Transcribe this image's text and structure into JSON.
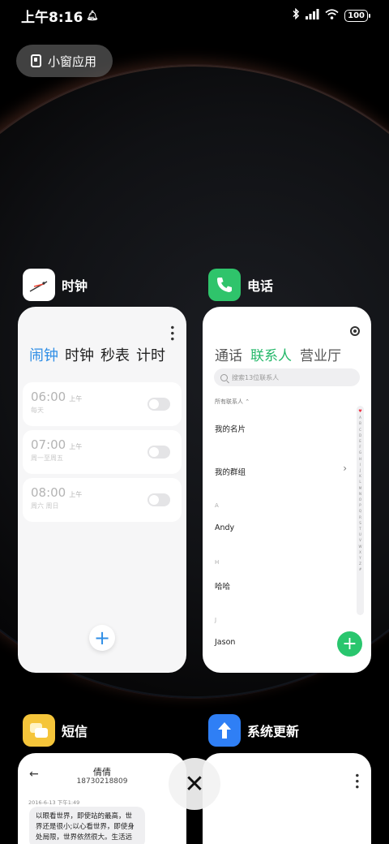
{
  "status_bar": {
    "time": "上午8:16",
    "battery": "100"
  },
  "pill": {
    "label": "小窗应用"
  },
  "apps": {
    "clock": {
      "name": "时钟",
      "tabs": [
        "闹钟",
        "时钟",
        "秒表",
        "计时"
      ],
      "alarms": [
        {
          "time": "06:00",
          "ampm": "上午",
          "repeat": "每天"
        },
        {
          "time": "07:00",
          "ampm": "上午",
          "repeat": "周一至周五"
        },
        {
          "time": "08:00",
          "ampm": "上午",
          "repeat": "周六 周日"
        }
      ],
      "add": "+"
    },
    "phone": {
      "name": "电话",
      "tabs": [
        "通话",
        "联系人",
        "营业厅"
      ],
      "search_placeholder": "搜索13位联系人",
      "filter": "所有联系人",
      "rows": {
        "my_card": "我的名片",
        "my_groups": "我的群组",
        "section_a": "A",
        "andy": "Andy",
        "section_h": "H",
        "haha": "哈哈",
        "section_j": "J",
        "jason": "Jason"
      },
      "alphabet": [
        "♥",
        "A",
        "B",
        "C",
        "D",
        "E",
        "F",
        "G",
        "H",
        "I",
        "J",
        "K",
        "L",
        "M",
        "N",
        "O",
        "P",
        "Q",
        "R",
        "S",
        "T",
        "U",
        "V",
        "W",
        "X",
        "Y",
        "Z",
        "#"
      ],
      "add": "+"
    },
    "sms": {
      "name": "短信",
      "contact_name": "倩倩",
      "contact_number": "18730218809",
      "timestamp": "2016-6-13 下午1:49",
      "message": "以眼看世界，即使站的最高，世界还是很小;以心看世界，即使身处局限，世界依然很大。生活远"
    },
    "update": {
      "name": "系统更新"
    }
  },
  "colors": {
    "clock_accent": "#2f8ee6",
    "phone_accent": "#25b86a",
    "phone_icon": "#2fc46b",
    "sms_icon": "#f5c53a",
    "update_icon": "#2f7ff5"
  }
}
